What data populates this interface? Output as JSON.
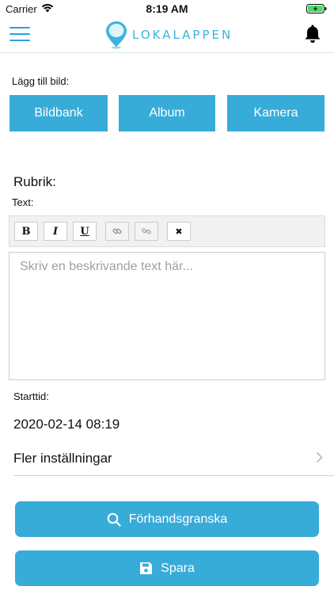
{
  "status_bar": {
    "carrier": "Carrier",
    "time": "8:19 AM"
  },
  "header": {
    "logo_text": "LOKALAPPEN"
  },
  "image_section": {
    "label": "Lägg till bild:",
    "buttons": [
      "Bildbank",
      "Album",
      "Kamera"
    ]
  },
  "form": {
    "rubrik_label": "Rubrik:",
    "text_label": "Text:",
    "text_placeholder": "Skriv en beskrivande text här...",
    "toolbar": {
      "bold": "B",
      "italic": "I",
      "underline": "U",
      "clear": "✖"
    },
    "starttid_label": "Starttid:",
    "starttid_value": "2020-02-14 08:19",
    "more_settings": "Fler inställningar"
  },
  "actions": {
    "preview": "Förhandsgranska",
    "save": "Spara"
  },
  "colors": {
    "accent": "#38acd9",
    "logo": "#3ab4dc"
  }
}
